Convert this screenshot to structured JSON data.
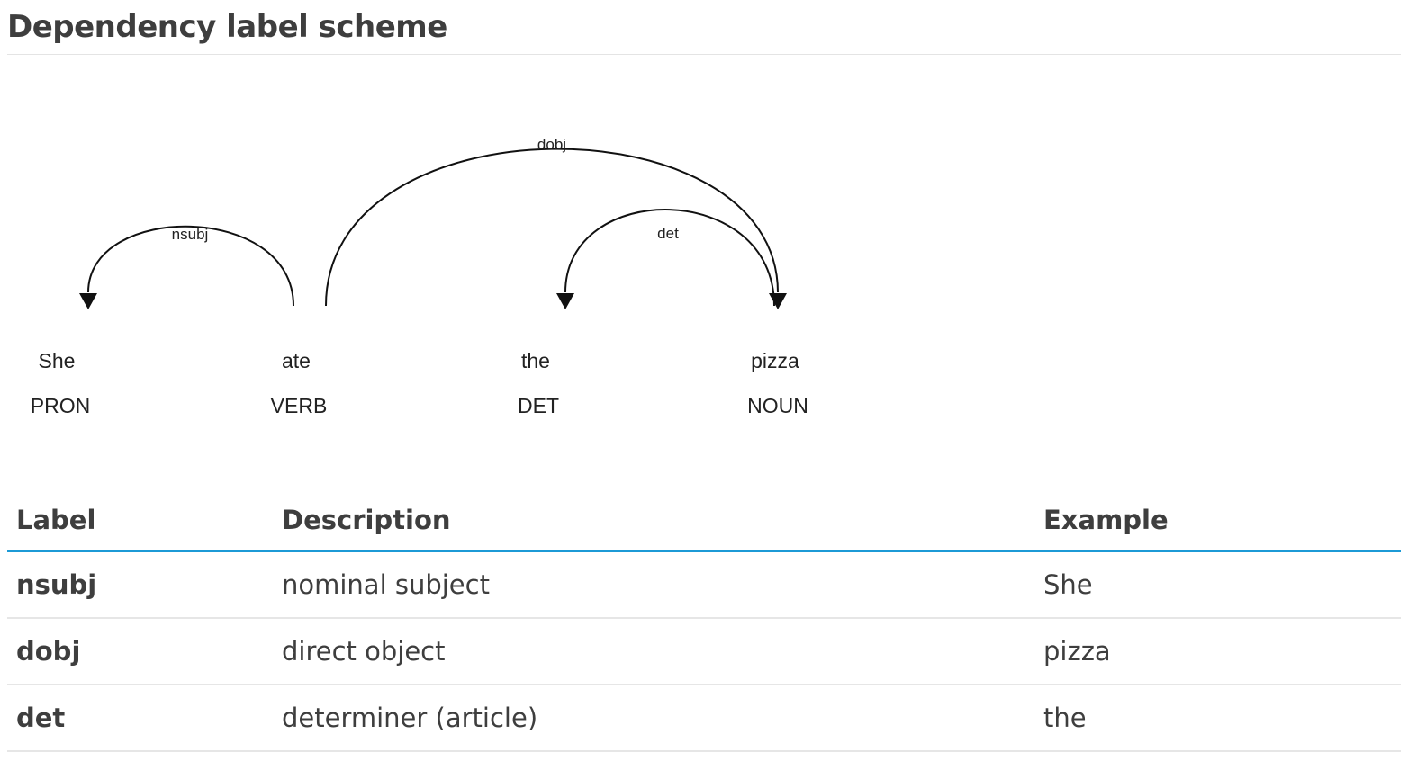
{
  "page": {
    "title": "Dependency label scheme"
  },
  "diagram": {
    "tokens": [
      {
        "word": "She",
        "tag": "PRON"
      },
      {
        "word": "ate",
        "tag": "VERB"
      },
      {
        "word": "the",
        "tag": "DET"
      },
      {
        "word": "pizza",
        "tag": "NOUN"
      }
    ],
    "arcs": [
      {
        "label": "nsubj",
        "from": 1,
        "to": 0
      },
      {
        "label": "dobj",
        "from": 1,
        "to": 3
      },
      {
        "label": "det",
        "from": 3,
        "to": 2
      }
    ]
  },
  "table": {
    "headers": {
      "label": "Label",
      "description": "Description",
      "example": "Example"
    },
    "rows": [
      {
        "label": "nsubj",
        "description": "nominal subject",
        "example": "She"
      },
      {
        "label": "dobj",
        "description": "direct object",
        "example": "pizza"
      },
      {
        "label": "det",
        "description": "determiner (article)",
        "example": "the"
      }
    ]
  },
  "colors": {
    "header_rule": "#1c9ad6",
    "row_rule": "#e6e6e6",
    "text": "#3e3e3e"
  }
}
